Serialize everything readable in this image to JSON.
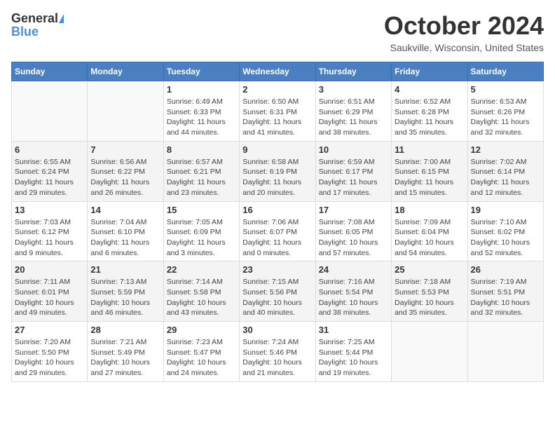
{
  "header": {
    "logo_general": "General",
    "logo_blue": "Blue",
    "month_title": "October 2024",
    "location": "Saukville, Wisconsin, United States"
  },
  "days_of_week": [
    "Sunday",
    "Monday",
    "Tuesday",
    "Wednesday",
    "Thursday",
    "Friday",
    "Saturday"
  ],
  "weeks": [
    [
      {
        "day": "",
        "info": ""
      },
      {
        "day": "",
        "info": ""
      },
      {
        "day": "1",
        "info": "Sunrise: 6:49 AM\nSunset: 6:33 PM\nDaylight: 11 hours and 44 minutes."
      },
      {
        "day": "2",
        "info": "Sunrise: 6:50 AM\nSunset: 6:31 PM\nDaylight: 11 hours and 41 minutes."
      },
      {
        "day": "3",
        "info": "Sunrise: 6:51 AM\nSunset: 6:29 PM\nDaylight: 11 hours and 38 minutes."
      },
      {
        "day": "4",
        "info": "Sunrise: 6:52 AM\nSunset: 6:28 PM\nDaylight: 11 hours and 35 minutes."
      },
      {
        "day": "5",
        "info": "Sunrise: 6:53 AM\nSunset: 6:26 PM\nDaylight: 11 hours and 32 minutes."
      }
    ],
    [
      {
        "day": "6",
        "info": "Sunrise: 6:55 AM\nSunset: 6:24 PM\nDaylight: 11 hours and 29 minutes."
      },
      {
        "day": "7",
        "info": "Sunrise: 6:56 AM\nSunset: 6:22 PM\nDaylight: 11 hours and 26 minutes."
      },
      {
        "day": "8",
        "info": "Sunrise: 6:57 AM\nSunset: 6:21 PM\nDaylight: 11 hours and 23 minutes."
      },
      {
        "day": "9",
        "info": "Sunrise: 6:58 AM\nSunset: 6:19 PM\nDaylight: 11 hours and 20 minutes."
      },
      {
        "day": "10",
        "info": "Sunrise: 6:59 AM\nSunset: 6:17 PM\nDaylight: 11 hours and 17 minutes."
      },
      {
        "day": "11",
        "info": "Sunrise: 7:00 AM\nSunset: 6:15 PM\nDaylight: 11 hours and 15 minutes."
      },
      {
        "day": "12",
        "info": "Sunrise: 7:02 AM\nSunset: 6:14 PM\nDaylight: 11 hours and 12 minutes."
      }
    ],
    [
      {
        "day": "13",
        "info": "Sunrise: 7:03 AM\nSunset: 6:12 PM\nDaylight: 11 hours and 9 minutes."
      },
      {
        "day": "14",
        "info": "Sunrise: 7:04 AM\nSunset: 6:10 PM\nDaylight: 11 hours and 6 minutes."
      },
      {
        "day": "15",
        "info": "Sunrise: 7:05 AM\nSunset: 6:09 PM\nDaylight: 11 hours and 3 minutes."
      },
      {
        "day": "16",
        "info": "Sunrise: 7:06 AM\nSunset: 6:07 PM\nDaylight: 11 hours and 0 minutes."
      },
      {
        "day": "17",
        "info": "Sunrise: 7:08 AM\nSunset: 6:05 PM\nDaylight: 10 hours and 57 minutes."
      },
      {
        "day": "18",
        "info": "Sunrise: 7:09 AM\nSunset: 6:04 PM\nDaylight: 10 hours and 54 minutes."
      },
      {
        "day": "19",
        "info": "Sunrise: 7:10 AM\nSunset: 6:02 PM\nDaylight: 10 hours and 52 minutes."
      }
    ],
    [
      {
        "day": "20",
        "info": "Sunrise: 7:11 AM\nSunset: 6:01 PM\nDaylight: 10 hours and 49 minutes."
      },
      {
        "day": "21",
        "info": "Sunrise: 7:13 AM\nSunset: 5:59 PM\nDaylight: 10 hours and 46 minutes."
      },
      {
        "day": "22",
        "info": "Sunrise: 7:14 AM\nSunset: 5:58 PM\nDaylight: 10 hours and 43 minutes."
      },
      {
        "day": "23",
        "info": "Sunrise: 7:15 AM\nSunset: 5:56 PM\nDaylight: 10 hours and 40 minutes."
      },
      {
        "day": "24",
        "info": "Sunrise: 7:16 AM\nSunset: 5:54 PM\nDaylight: 10 hours and 38 minutes."
      },
      {
        "day": "25",
        "info": "Sunrise: 7:18 AM\nSunset: 5:53 PM\nDaylight: 10 hours and 35 minutes."
      },
      {
        "day": "26",
        "info": "Sunrise: 7:19 AM\nSunset: 5:51 PM\nDaylight: 10 hours and 32 minutes."
      }
    ],
    [
      {
        "day": "27",
        "info": "Sunrise: 7:20 AM\nSunset: 5:50 PM\nDaylight: 10 hours and 29 minutes."
      },
      {
        "day": "28",
        "info": "Sunrise: 7:21 AM\nSunset: 5:49 PM\nDaylight: 10 hours and 27 minutes."
      },
      {
        "day": "29",
        "info": "Sunrise: 7:23 AM\nSunset: 5:47 PM\nDaylight: 10 hours and 24 minutes."
      },
      {
        "day": "30",
        "info": "Sunrise: 7:24 AM\nSunset: 5:46 PM\nDaylight: 10 hours and 21 minutes."
      },
      {
        "day": "31",
        "info": "Sunrise: 7:25 AM\nSunset: 5:44 PM\nDaylight: 10 hours and 19 minutes."
      },
      {
        "day": "",
        "info": ""
      },
      {
        "day": "",
        "info": ""
      }
    ]
  ]
}
